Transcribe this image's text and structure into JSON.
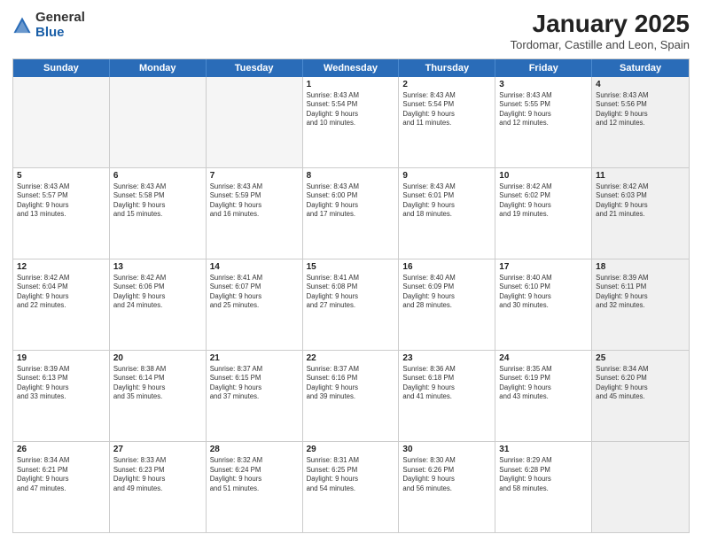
{
  "header": {
    "logo_general": "General",
    "logo_blue": "Blue",
    "main_title": "January 2025",
    "subtitle": "Tordomar, Castille and Leon, Spain"
  },
  "weekdays": [
    "Sunday",
    "Monday",
    "Tuesday",
    "Wednesday",
    "Thursday",
    "Friday",
    "Saturday"
  ],
  "rows": [
    [
      {
        "day": "",
        "info": "",
        "empty": true
      },
      {
        "day": "",
        "info": "",
        "empty": true
      },
      {
        "day": "",
        "info": "",
        "empty": true
      },
      {
        "day": "1",
        "info": "Sunrise: 8:43 AM\nSunset: 5:54 PM\nDaylight: 9 hours\nand 10 minutes."
      },
      {
        "day": "2",
        "info": "Sunrise: 8:43 AM\nSunset: 5:54 PM\nDaylight: 9 hours\nand 11 minutes."
      },
      {
        "day": "3",
        "info": "Sunrise: 8:43 AM\nSunset: 5:55 PM\nDaylight: 9 hours\nand 12 minutes."
      },
      {
        "day": "4",
        "info": "Sunrise: 8:43 AM\nSunset: 5:56 PM\nDaylight: 9 hours\nand 12 minutes.",
        "shaded": true
      }
    ],
    [
      {
        "day": "5",
        "info": "Sunrise: 8:43 AM\nSunset: 5:57 PM\nDaylight: 9 hours\nand 13 minutes."
      },
      {
        "day": "6",
        "info": "Sunrise: 8:43 AM\nSunset: 5:58 PM\nDaylight: 9 hours\nand 15 minutes."
      },
      {
        "day": "7",
        "info": "Sunrise: 8:43 AM\nSunset: 5:59 PM\nDaylight: 9 hours\nand 16 minutes."
      },
      {
        "day": "8",
        "info": "Sunrise: 8:43 AM\nSunset: 6:00 PM\nDaylight: 9 hours\nand 17 minutes."
      },
      {
        "day": "9",
        "info": "Sunrise: 8:43 AM\nSunset: 6:01 PM\nDaylight: 9 hours\nand 18 minutes."
      },
      {
        "day": "10",
        "info": "Sunrise: 8:42 AM\nSunset: 6:02 PM\nDaylight: 9 hours\nand 19 minutes."
      },
      {
        "day": "11",
        "info": "Sunrise: 8:42 AM\nSunset: 6:03 PM\nDaylight: 9 hours\nand 21 minutes.",
        "shaded": true
      }
    ],
    [
      {
        "day": "12",
        "info": "Sunrise: 8:42 AM\nSunset: 6:04 PM\nDaylight: 9 hours\nand 22 minutes."
      },
      {
        "day": "13",
        "info": "Sunrise: 8:42 AM\nSunset: 6:06 PM\nDaylight: 9 hours\nand 24 minutes."
      },
      {
        "day": "14",
        "info": "Sunrise: 8:41 AM\nSunset: 6:07 PM\nDaylight: 9 hours\nand 25 minutes."
      },
      {
        "day": "15",
        "info": "Sunrise: 8:41 AM\nSunset: 6:08 PM\nDaylight: 9 hours\nand 27 minutes."
      },
      {
        "day": "16",
        "info": "Sunrise: 8:40 AM\nSunset: 6:09 PM\nDaylight: 9 hours\nand 28 minutes."
      },
      {
        "day": "17",
        "info": "Sunrise: 8:40 AM\nSunset: 6:10 PM\nDaylight: 9 hours\nand 30 minutes."
      },
      {
        "day": "18",
        "info": "Sunrise: 8:39 AM\nSunset: 6:11 PM\nDaylight: 9 hours\nand 32 minutes.",
        "shaded": true
      }
    ],
    [
      {
        "day": "19",
        "info": "Sunrise: 8:39 AM\nSunset: 6:13 PM\nDaylight: 9 hours\nand 33 minutes."
      },
      {
        "day": "20",
        "info": "Sunrise: 8:38 AM\nSunset: 6:14 PM\nDaylight: 9 hours\nand 35 minutes."
      },
      {
        "day": "21",
        "info": "Sunrise: 8:37 AM\nSunset: 6:15 PM\nDaylight: 9 hours\nand 37 minutes."
      },
      {
        "day": "22",
        "info": "Sunrise: 8:37 AM\nSunset: 6:16 PM\nDaylight: 9 hours\nand 39 minutes."
      },
      {
        "day": "23",
        "info": "Sunrise: 8:36 AM\nSunset: 6:18 PM\nDaylight: 9 hours\nand 41 minutes."
      },
      {
        "day": "24",
        "info": "Sunrise: 8:35 AM\nSunset: 6:19 PM\nDaylight: 9 hours\nand 43 minutes."
      },
      {
        "day": "25",
        "info": "Sunrise: 8:34 AM\nSunset: 6:20 PM\nDaylight: 9 hours\nand 45 minutes.",
        "shaded": true
      }
    ],
    [
      {
        "day": "26",
        "info": "Sunrise: 8:34 AM\nSunset: 6:21 PM\nDaylight: 9 hours\nand 47 minutes."
      },
      {
        "day": "27",
        "info": "Sunrise: 8:33 AM\nSunset: 6:23 PM\nDaylight: 9 hours\nand 49 minutes."
      },
      {
        "day": "28",
        "info": "Sunrise: 8:32 AM\nSunset: 6:24 PM\nDaylight: 9 hours\nand 51 minutes."
      },
      {
        "day": "29",
        "info": "Sunrise: 8:31 AM\nSunset: 6:25 PM\nDaylight: 9 hours\nand 54 minutes."
      },
      {
        "day": "30",
        "info": "Sunrise: 8:30 AM\nSunset: 6:26 PM\nDaylight: 9 hours\nand 56 minutes."
      },
      {
        "day": "31",
        "info": "Sunrise: 8:29 AM\nSunset: 6:28 PM\nDaylight: 9 hours\nand 58 minutes."
      },
      {
        "day": "",
        "info": "",
        "empty": true,
        "shaded": true
      }
    ]
  ]
}
